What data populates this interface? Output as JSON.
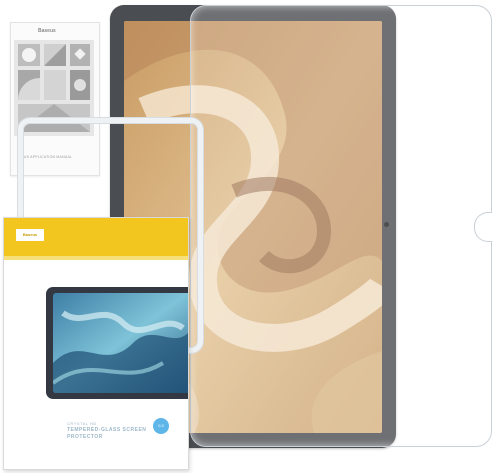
{
  "image": {
    "subject": "tablet with tempered glass screen protector and retail package",
    "colors": {
      "tablet_frame": "#4a4d52",
      "screen_wallpaper": "#d9b07a",
      "box_accent": "#f2c61f",
      "box_text": "#9db8c9",
      "badge": "#5db5e8"
    }
  },
  "instruction_card": {
    "brand": "Baseus",
    "title": "GUS APPLICATION MANUAL"
  },
  "retail_box": {
    "brand": "Baseus",
    "caption_line_1": "CRYSTAL HD",
    "caption_line_2": "TEMPERED-GLASS SCREEN",
    "caption_line_3": "PROTECTOR",
    "badge": "0.3"
  }
}
